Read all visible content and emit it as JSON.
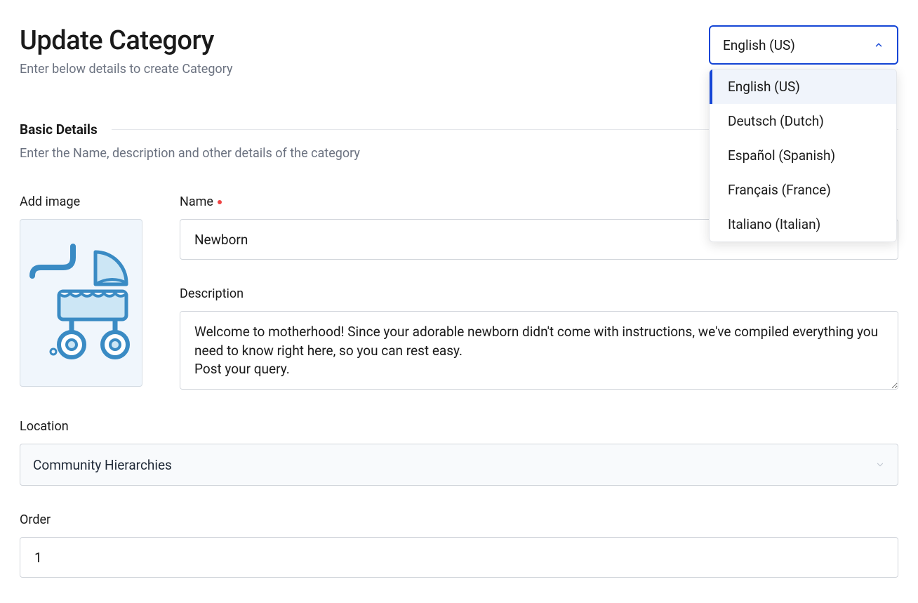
{
  "header": {
    "title": "Update Category",
    "subtitle": "Enter below details to create Category"
  },
  "language": {
    "selected": "English (US)",
    "options": [
      "English (US)",
      "Deutsch (Dutch)",
      "Español (Spanish)",
      "Français (France)",
      "Italiano (Italian)"
    ]
  },
  "section": {
    "title": "Basic Details",
    "subtitle": "Enter the Name, description and other details of the category"
  },
  "fields": {
    "addImageLabel": "Add image",
    "nameLabel": "Name",
    "nameValue": "Newborn",
    "descriptionLabel": "Description",
    "descriptionValue": "Welcome to motherhood! Since your adorable newborn didn't come with instructions, we've compiled everything you need to know right here, so you can rest easy.\nPost your query.",
    "locationLabel": "Location",
    "locationValue": "Community Hierarchies",
    "orderLabel": "Order",
    "orderValue": "1"
  }
}
